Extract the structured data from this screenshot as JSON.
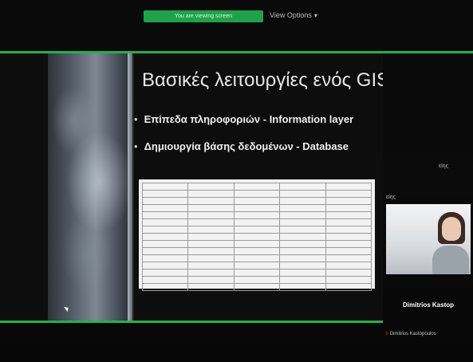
{
  "topbar": {
    "share_banner": "You are viewing screen",
    "view_options": "View Options",
    "view_options_icon": "chevron-down-icon"
  },
  "slide": {
    "title": "Βασικές λειτουργίες ενός GIS",
    "bullets": [
      "Επίπεδα πληροφοριών - Information layer",
      "Δημιουργία βάσης δεδομένων - Database"
    ]
  },
  "side": {
    "label_1": "είης",
    "label_2": "είης"
  },
  "participant": {
    "name": "Dimitrios Kastop",
    "bottom_name": "Dimitrios Kastopoulos"
  },
  "colors": {
    "accent_green": "#1fb34a",
    "background": "#080808"
  }
}
